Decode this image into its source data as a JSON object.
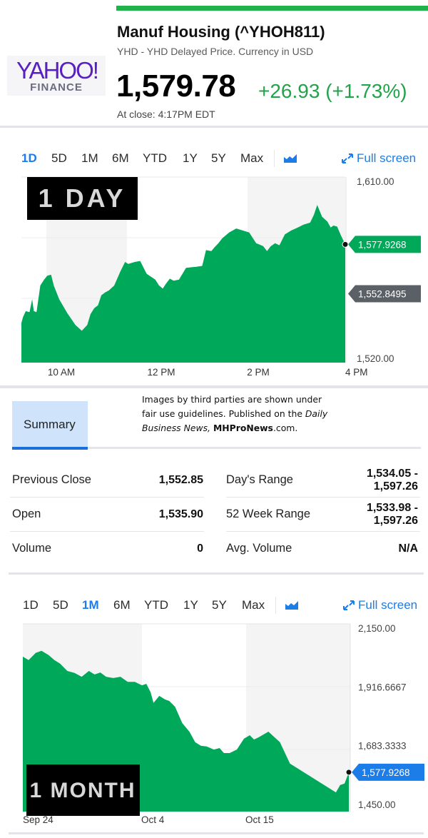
{
  "header": {
    "logo_primary": "YAHOO!",
    "logo_secondary": "FINANCE",
    "title": "Manuf Housing (^YHOH811)",
    "subtitle": "YHD - YHD Delayed Price. Currency in USD",
    "price": "1,579.78",
    "change": "+26.93 (+1.73%)",
    "close_time": "At close: 4:17PM EDT"
  },
  "colors": {
    "brand": "#5a1fc1",
    "positive": "#21a34a",
    "accent": "#1d7de8",
    "chart_fill": "#00a85a",
    "prev_close_tag": "#5b6066"
  },
  "chart_1d_toolbar": {
    "ranges": [
      "1D",
      "5D",
      "1M",
      "6M",
      "YTD",
      "1Y",
      "5Y",
      "Max"
    ],
    "active": "1D",
    "chart_type_icon": "area-chart-icon",
    "fullscreen_label": "Full screen",
    "fullscreen_icon": "expand-arrows-icon"
  },
  "chart_1m_toolbar": {
    "ranges": [
      "1D",
      "5D",
      "1M",
      "6M",
      "YTD",
      "1Y",
      "5Y",
      "Max"
    ],
    "active": "1M",
    "chart_type_icon": "area-chart-icon",
    "fullscreen_label": "Full screen",
    "fullscreen_icon": "expand-arrows-icon"
  },
  "overlays": {
    "day_badge": "1 DAY",
    "month_badge": "1 MONTH"
  },
  "summary": {
    "tab_label": "Summary",
    "credit_line1": "Images by third parties are shown under",
    "credit_line2_a": "fair use guidelines.  Published on the ",
    "credit_line2_b": "Daily",
    "credit_line3_a": "Business News, ",
    "credit_line3_b": "MHProNews",
    "credit_line3_c": ".com.",
    "left": [
      {
        "label": "Previous Close",
        "value": "1,552.85"
      },
      {
        "label": "Open",
        "value": "1,535.90"
      },
      {
        "label": "Volume",
        "value": "0"
      }
    ],
    "right": [
      {
        "label": "Day's Range",
        "value_line1": "1,534.05 -",
        "value_line2": "1,597.26"
      },
      {
        "label": "52 Week Range",
        "value_line1": "1,533.98 -",
        "value_line2": "1,597.26"
      },
      {
        "label": "Avg. Volume",
        "value": "N/A"
      }
    ]
  },
  "chart_data": [
    {
      "type": "area",
      "title": "1 Day",
      "xlabel": "",
      "ylabel": "",
      "x_ticks": [
        "10 AM",
        "12 PM",
        "2 PM",
        "4 PM"
      ],
      "y_ticks": [
        "1,610.00",
        "1,520.00"
      ],
      "ylim": [
        1520,
        1610
      ],
      "grid": true,
      "current_value_label": "1,577.9268",
      "previous_close_label": "1,552.8495",
      "previous_close": 1552.8495,
      "current_value": 1577.9268,
      "x_hours": [
        9.5,
        9.53,
        9.58,
        9.65,
        9.7,
        9.73,
        9.78,
        9.85,
        9.92,
        9.98,
        10.05,
        10.1,
        10.2,
        10.35,
        10.5,
        10.62,
        10.72,
        10.78,
        10.85,
        10.92,
        10.98,
        11.05,
        11.12,
        11.22,
        11.33,
        11.42,
        11.48,
        11.6,
        11.7,
        11.82,
        11.98,
        12.05,
        12.12,
        12.18,
        12.25,
        12.32,
        12.42,
        12.55,
        12.65,
        12.73,
        12.85,
        12.92,
        13.02,
        13.08,
        13.15,
        13.22,
        13.35,
        13.48,
        13.6,
        13.72,
        13.85,
        13.9,
        13.98,
        14.05,
        14.12,
        14.2,
        14.28,
        14.38,
        14.5,
        14.62,
        14.73,
        14.85,
        14.92,
        14.98,
        15.07,
        15.17,
        15.23,
        15.28,
        15.35,
        15.42,
        15.5
      ],
      "values": [
        1538,
        1541,
        1544,
        1543.5,
        1550,
        1544,
        1543.5,
        1557,
        1560,
        1562,
        1562.5,
        1557,
        1550,
        1543,
        1537,
        1534,
        1537,
        1542.5,
        1545.5,
        1547,
        1552,
        1553.5,
        1554.5,
        1557,
        1564,
        1569,
        1568,
        1569,
        1569.5,
        1563,
        1560,
        1557,
        1555.5,
        1558,
        1560.5,
        1559.5,
        1560,
        1566,
        1566.3,
        1566.5,
        1567,
        1575,
        1574.5,
        1576.5,
        1578.5,
        1581,
        1584,
        1586,
        1585,
        1584,
        1578.5,
        1578,
        1577,
        1574.5,
        1577,
        1578.5,
        1577.5,
        1583,
        1585,
        1586.5,
        1588,
        1589,
        1593,
        1598,
        1592,
        1589.5,
        1586.5,
        1587.5,
        1587,
        1582.5,
        1577.93
      ]
    },
    {
      "type": "area",
      "title": "1 Month",
      "xlabel": "",
      "ylabel": "",
      "x_ticks": [
        "Sep 24",
        "Oct 4",
        "Oct 15"
      ],
      "y_ticks": [
        "2,150.00",
        "1,916.6667",
        "1,683.3333",
        "1,450.00"
      ],
      "ylim": [
        1450,
        2150
      ],
      "grid": true,
      "current_value_label": "1,577.9268",
      "current_value": 1577.9268,
      "x_index": [
        0,
        0.2,
        0.45,
        0.65,
        0.9,
        1.1,
        1.3,
        1.55,
        1.8,
        2.05,
        2.3,
        2.5,
        2.7,
        2.9,
        3.15,
        3.4,
        3.65,
        3.9,
        4.15,
        4.3,
        4.45,
        4.55,
        4.75,
        4.95,
        5.1,
        5.3,
        5.55,
        5.8,
        6.0,
        6.2,
        6.4,
        6.65,
        6.85,
        7.0,
        7.2,
        7.45,
        7.7,
        7.9,
        8.05,
        8.2,
        8.55,
        8.95,
        9.3,
        10.9,
        11.05,
        11.2,
        11.35
      ],
      "values": [
        2037,
        2023,
        2052,
        2060,
        2043,
        2023,
        2009,
        1980,
        1972,
        1957,
        1980,
        1966,
        1974,
        1957,
        1952,
        1957,
        1937,
        1937,
        1923,
        1929,
        1895,
        1853,
        1881,
        1867,
        1861,
        1838,
        1773,
        1739,
        1697,
        1683,
        1680,
        1668,
        1674,
        1654,
        1654,
        1668,
        1711,
        1725,
        1708,
        1716,
        1739,
        1697,
        1612,
        1498,
        1527,
        1533,
        1577.93
      ]
    }
  ]
}
